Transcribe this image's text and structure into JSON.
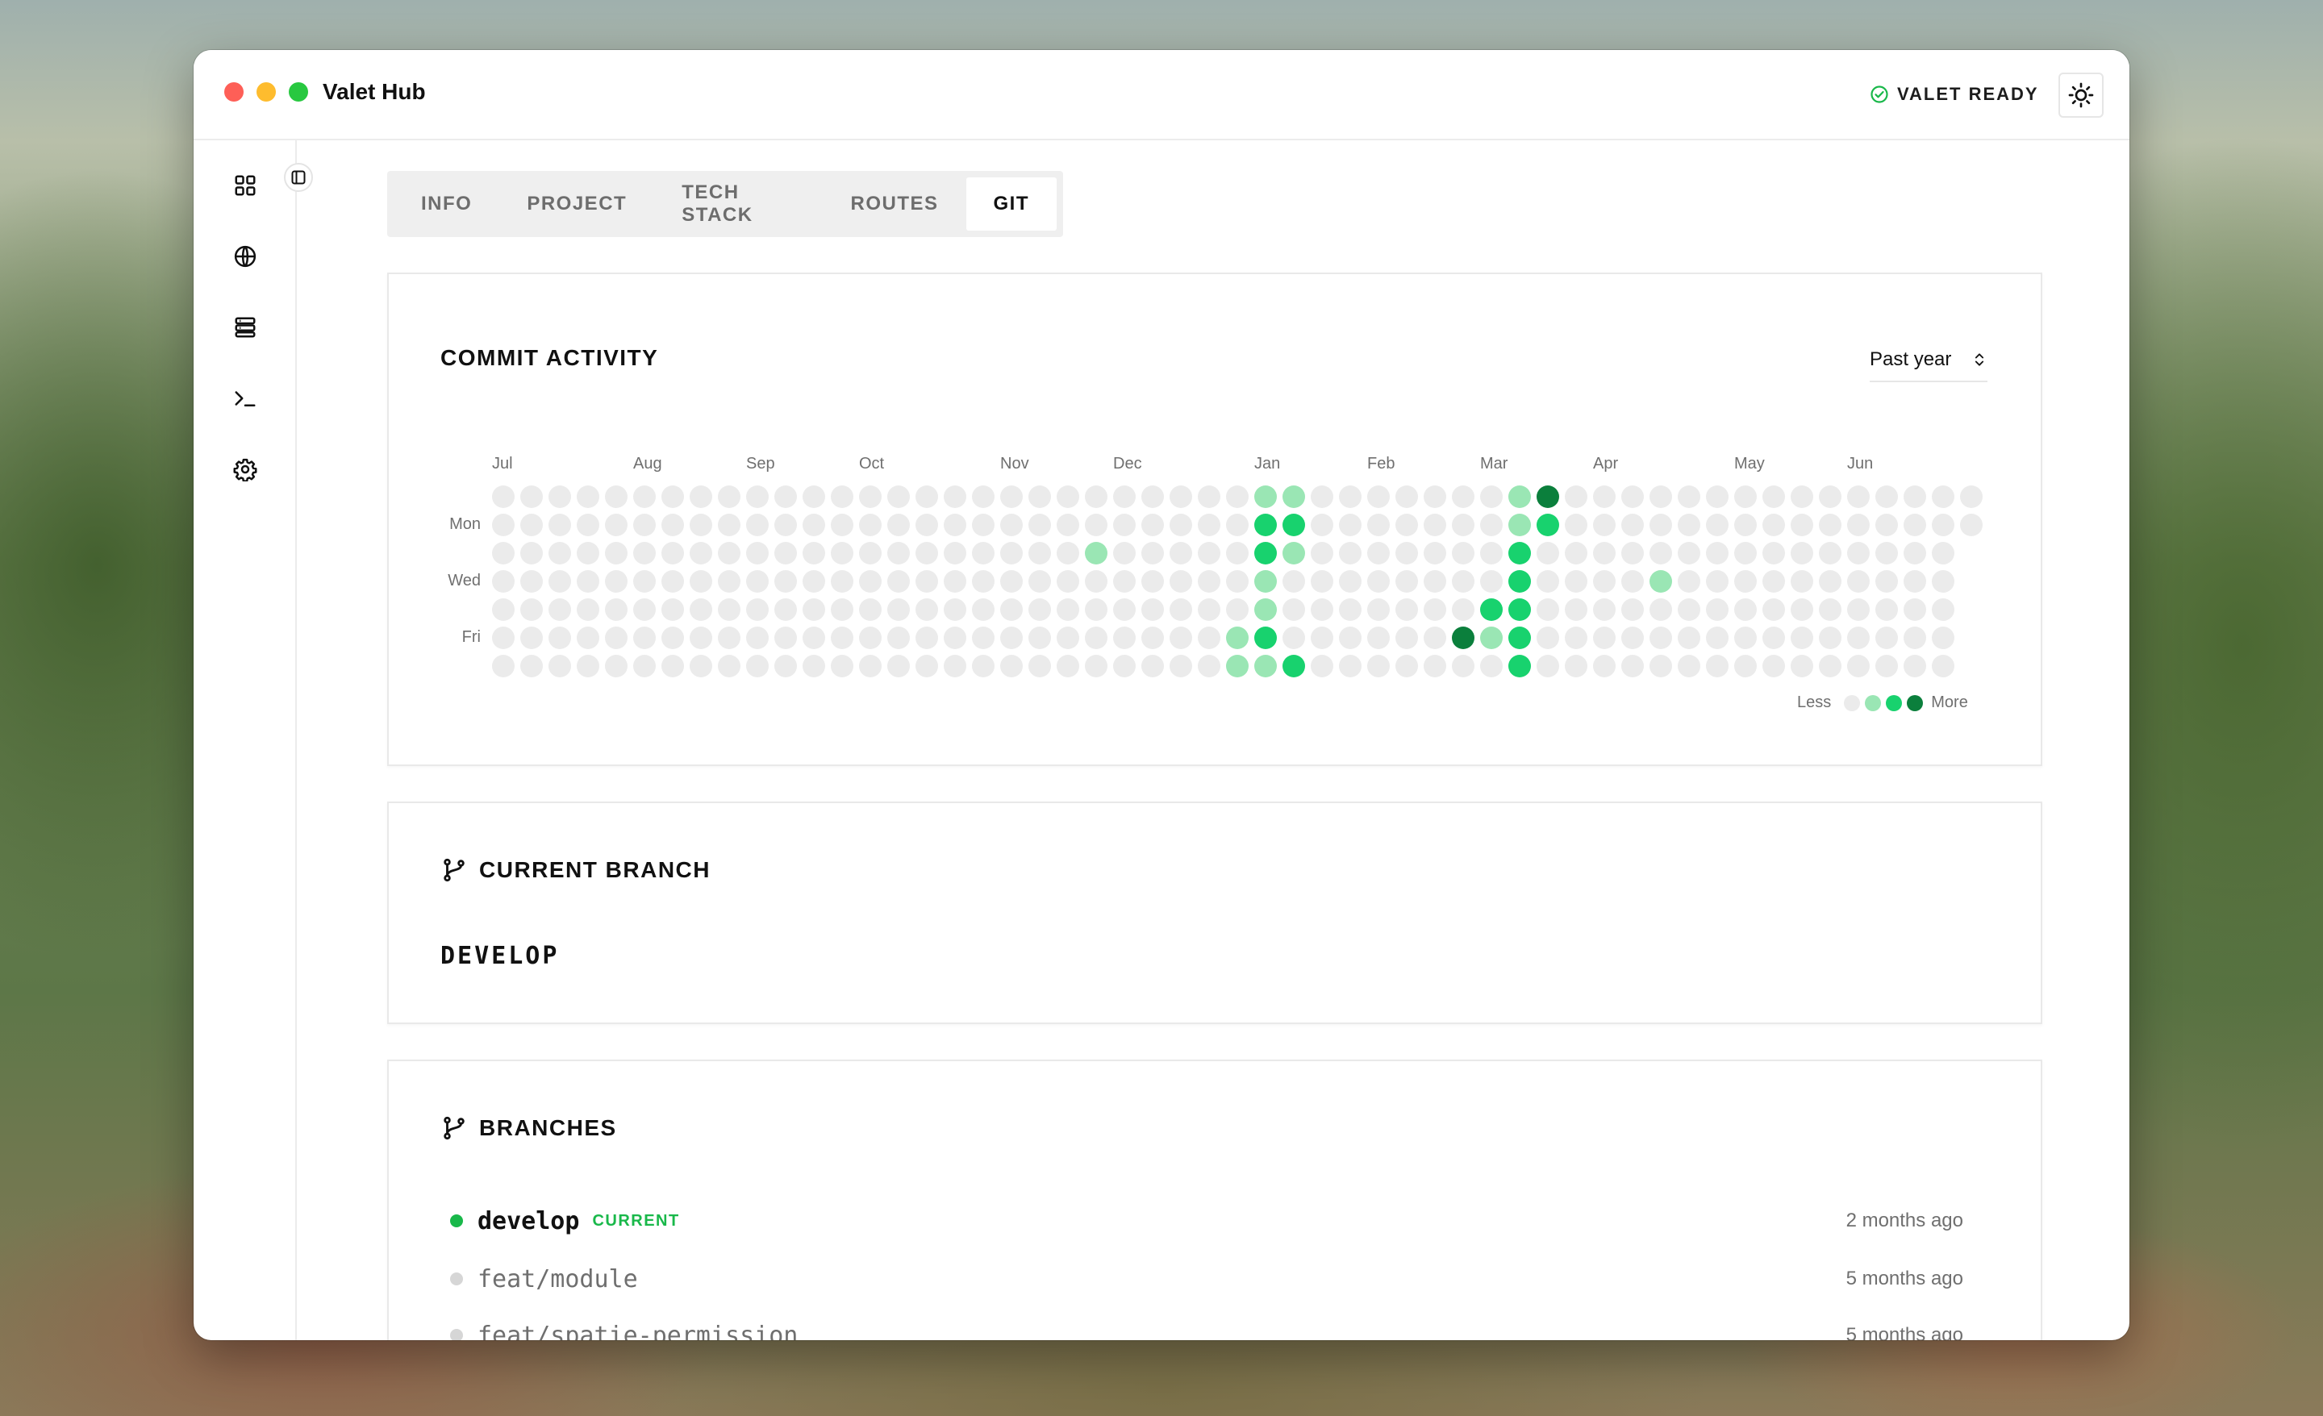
{
  "window": {
    "title": "Valet Hub"
  },
  "status": {
    "label": "VALET READY",
    "icon": "check-circle-icon",
    "color": "#19b84a"
  },
  "theme_toggle": {
    "icon": "sun-icon"
  },
  "sidebar": {
    "items": [
      {
        "name": "dashboard",
        "icon": "grid-icon"
      },
      {
        "name": "sites",
        "icon": "globe-icon"
      },
      {
        "name": "services",
        "icon": "server-icon"
      },
      {
        "name": "terminal",
        "icon": "terminal-icon"
      },
      {
        "name": "settings",
        "icon": "gear-icon"
      }
    ],
    "collapse_icon": "sidebar-collapse-icon"
  },
  "tabs": [
    {
      "label": "INFO",
      "active": false
    },
    {
      "label": "PROJECT",
      "active": false
    },
    {
      "label": "TECH STACK",
      "active": false
    },
    {
      "label": "ROUTES",
      "active": false
    },
    {
      "label": "GIT",
      "active": true
    }
  ],
  "commit_activity": {
    "title": "COMMIT ACTIVITY",
    "range": "Past year",
    "months": [
      "Jul",
      "Aug",
      "Sep",
      "Oct",
      "Nov",
      "Dec",
      "Jan",
      "Feb",
      "Mar",
      "Apr",
      "May",
      "Jun"
    ],
    "month_weeks": [
      0,
      5,
      9,
      13,
      18,
      22,
      27,
      31,
      35,
      39,
      44,
      48
    ],
    "day_labels": [
      "",
      "Mon",
      "",
      "Wed",
      "",
      "Fri",
      ""
    ],
    "weeks": 53,
    "last_week_days": 2,
    "levels": {
      "21,2": 1,
      "26,5": 1,
      "26,6": 1,
      "27,0": 1,
      "27,1": 2,
      "27,2": 2,
      "27,3": 1,
      "27,4": 1,
      "27,5": 2,
      "27,6": 1,
      "28,0": 1,
      "28,1": 2,
      "28,2": 1,
      "28,6": 2,
      "34,5": 3,
      "35,4": 2,
      "35,5": 1,
      "36,0": 1,
      "36,1": 1,
      "36,2": 2,
      "36,3": 2,
      "36,4": 2,
      "36,5": 2,
      "36,6": 2,
      "37,0": 3,
      "37,1": 2,
      "41,3": 1
    },
    "legend": {
      "less": "Less",
      "more": "More"
    },
    "colors": [
      "#ebebeb",
      "#9ae6b4",
      "#18d26e",
      "#0b7f3c"
    ]
  },
  "current_branch": {
    "title": "CURRENT BRANCH",
    "icon": "git-branch-icon",
    "name": "DEVELOP"
  },
  "branches": {
    "title": "BRANCHES",
    "icon": "git-branch-icon",
    "items": [
      {
        "name": "develop",
        "badge": "CURRENT",
        "time": "2 months ago",
        "current": true
      },
      {
        "name": "feat/module",
        "badge": "",
        "time": "5 months ago",
        "current": false
      },
      {
        "name": "feat/spatie-permission",
        "badge": "",
        "time": "5 months ago",
        "current": false
      }
    ]
  }
}
